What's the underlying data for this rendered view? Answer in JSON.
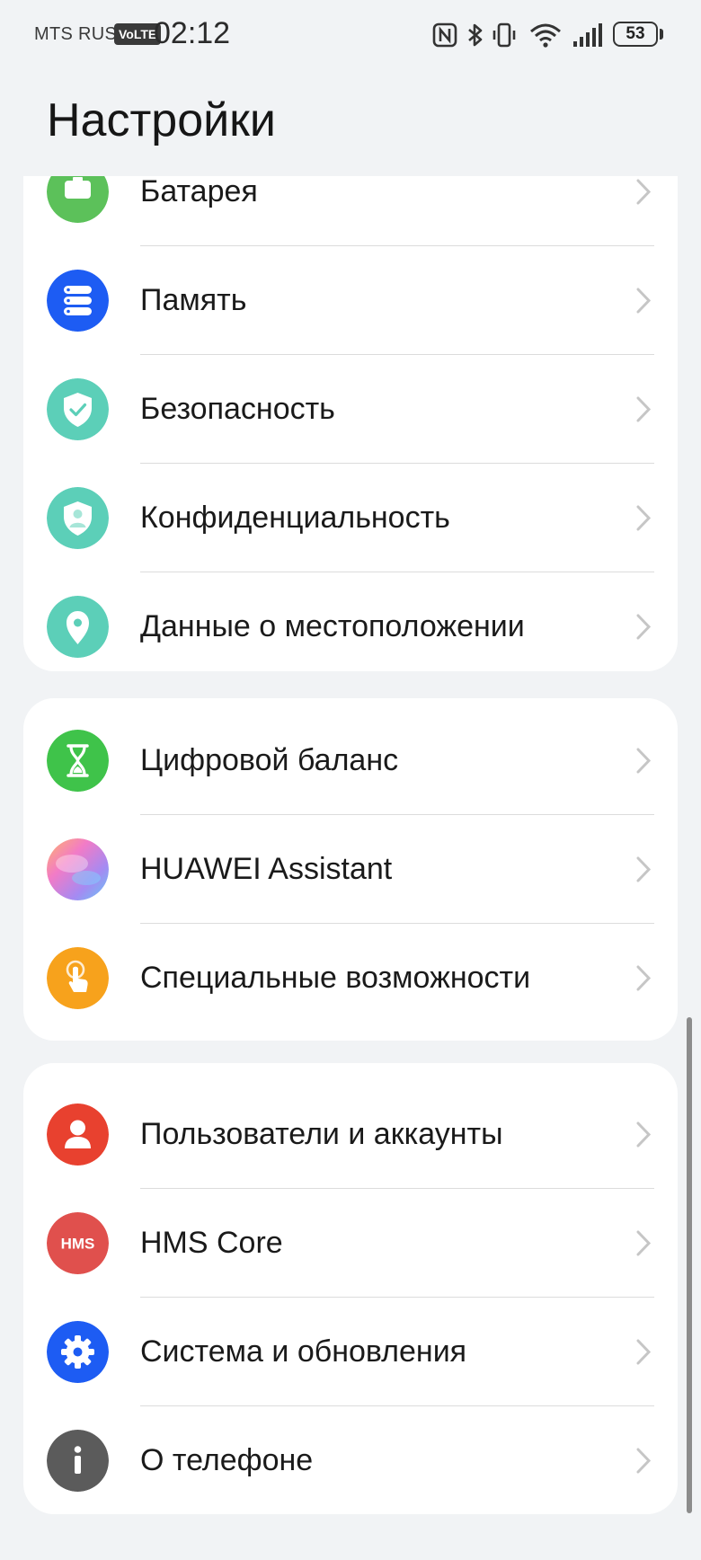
{
  "status_bar": {
    "carrier": "MTS RUS",
    "volte": "VoLTE",
    "time": "02:12",
    "battery_percent": "53",
    "icons": [
      "nfc-icon",
      "bluetooth-icon",
      "vibrate-icon",
      "wifi-icon",
      "signal-icon",
      "battery-icon"
    ]
  },
  "header": {
    "title": "Настройки"
  },
  "groups": [
    {
      "items": [
        {
          "label": "Батарея",
          "icon": "battery-icon",
          "color": "#5cc15a"
        },
        {
          "label": "Память",
          "icon": "storage-icon",
          "color": "#1d5cf3"
        },
        {
          "label": "Безопасность",
          "icon": "shield-check-icon",
          "color": "#5ccfb8"
        },
        {
          "label": "Конфиденциальность",
          "icon": "privacy-shield-icon",
          "color": "#5ccfb8"
        },
        {
          "label": "Данные о местоположении",
          "icon": "location-pin-icon",
          "color": "#5ccfb8"
        }
      ]
    },
    {
      "items": [
        {
          "label": "Цифровой баланс",
          "icon": "hourglass-icon",
          "color": "#3fc34a"
        },
        {
          "label": "HUAWEI Assistant",
          "icon": "assistant-orb-icon",
          "color": "#c98ee8"
        },
        {
          "label": "Специальные возможности",
          "icon": "accessibility-hand-icon",
          "color": "#f7a21c"
        }
      ]
    },
    {
      "items": [
        {
          "label": "Пользователи и аккаунты",
          "icon": "user-icon",
          "color": "#e8412f"
        },
        {
          "label": "HMS Core",
          "icon": "hms-icon",
          "icon_text": "HMS",
          "color": "#e0504d"
        },
        {
          "label": "Система и обновления",
          "icon": "gear-icon",
          "color": "#1d5cf3"
        },
        {
          "label": "О телефоне",
          "icon": "info-icon",
          "color": "#5b5b5b"
        }
      ]
    }
  ]
}
